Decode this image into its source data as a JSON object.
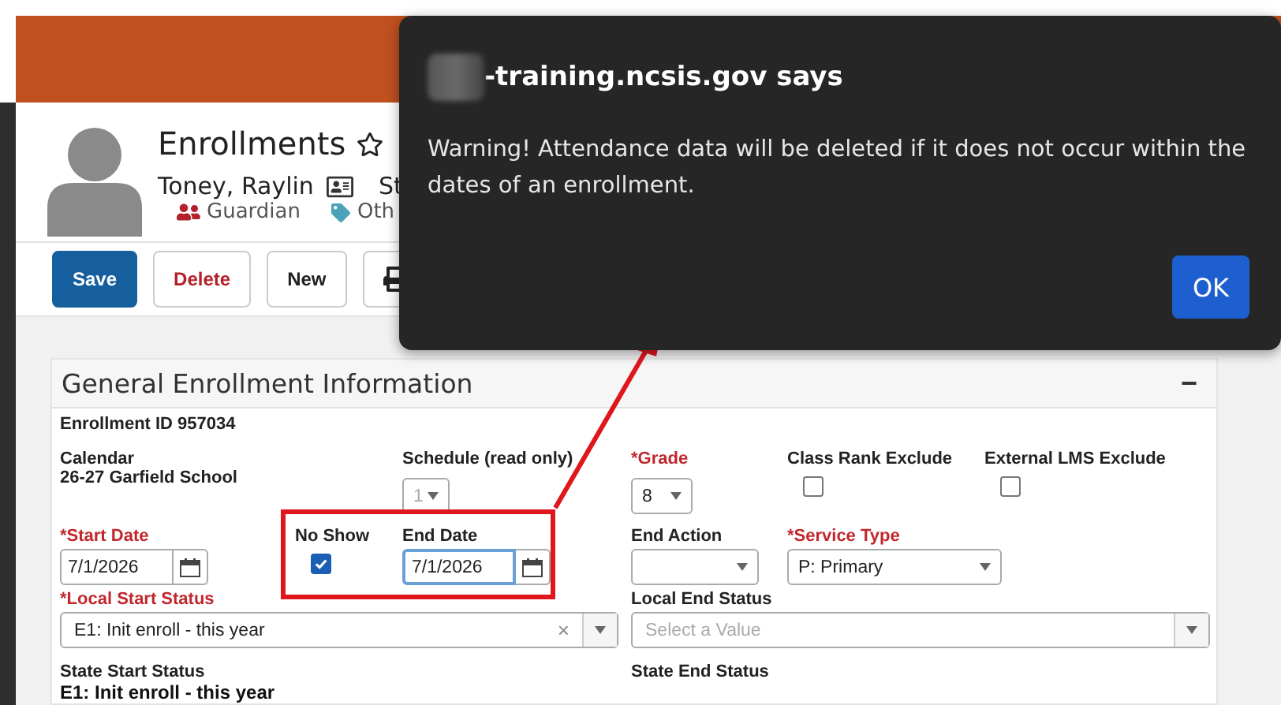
{
  "header": {
    "title": "Enrollments",
    "student_name": "Toney, Raylin",
    "student_name_cut": "St",
    "links": [
      {
        "kind": "guardian",
        "label": "Guardian"
      },
      {
        "kind": "tag",
        "label": "Oth"
      }
    ]
  },
  "toolbar": [
    {
      "kind": "primary",
      "label": "Save"
    },
    {
      "kind": "danger",
      "label": "Delete"
    },
    {
      "kind": "plain",
      "label": "New"
    },
    {
      "kind": "print"
    }
  ],
  "panel": {
    "title": "General Enrollment Information",
    "collapse": "−",
    "enrollment_id": "Enrollment ID 957034",
    "calendar": {
      "label": "Calendar",
      "value": "26-27 Garfield School"
    },
    "schedule": {
      "label": "Schedule (read only)",
      "value": "1",
      "disabled": true
    },
    "grade": {
      "label": "*Grade",
      "required": true,
      "value": "8"
    },
    "checks": [
      {
        "label": "Class Rank Exclude",
        "checked": false
      },
      {
        "label": "External LMS Exclude",
        "checked": false
      }
    ],
    "start_date": {
      "label": "*Start Date",
      "required": true,
      "value": "7/1/2026"
    },
    "no_show": {
      "label": "No Show",
      "checked": true
    },
    "end_date": {
      "label": "End Date",
      "value": "7/1/2026",
      "focused": true
    },
    "end_action": {
      "label": "End Action",
      "required": false
    },
    "service_type": {
      "label": "*Service Type",
      "required": true,
      "value": "P: Primary"
    },
    "local_start_status": {
      "label": "*Local Start Status",
      "required": true,
      "value": "E1: Init enroll - this year",
      "clear": "×"
    },
    "local_end_status": {
      "label": "Local End Status",
      "required": false,
      "placeholder": "Select a Value"
    },
    "state_start_status": {
      "label": "State Start Status",
      "value": "E1: Init enroll - this year"
    },
    "state_end_status": {
      "label": "State End Status"
    }
  },
  "dialog": {
    "title": "-training.ncsis.gov says",
    "message": "Warning! Attendance data will be deleted if it does not occur within the dates of an enrollment.",
    "button": "OK"
  }
}
